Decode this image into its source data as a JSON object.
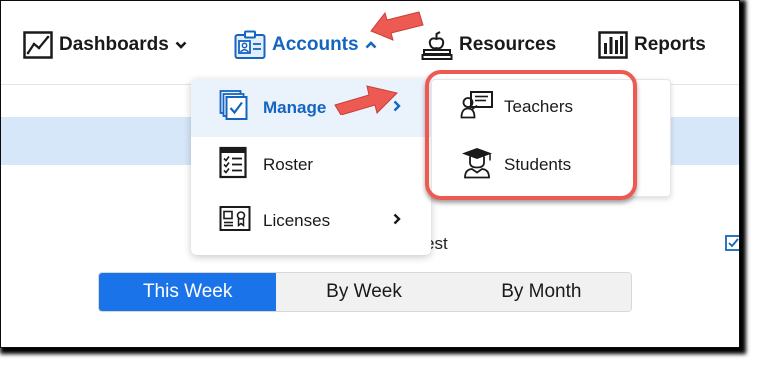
{
  "nav": {
    "dashboards": {
      "label": "Dashboards",
      "icon": "line-chart-icon"
    },
    "accounts": {
      "label": "Accounts",
      "icon": "id-card-icon",
      "color": "#1565c0"
    },
    "resources": {
      "label": "Resources",
      "icon": "apple-books-icon"
    },
    "reports": {
      "label": "Reports",
      "icon": "bar-chart-icon"
    }
  },
  "accounts_menu": {
    "items": [
      {
        "label": "Manage",
        "icon": "stacked-checklist-icon",
        "has_submenu": true,
        "active": true
      },
      {
        "label": "Roster",
        "icon": "roster-list-icon",
        "has_submenu": false
      },
      {
        "label": "Licenses",
        "icon": "license-certificate-icon",
        "has_submenu": true
      }
    ]
  },
  "manage_submenu": {
    "items": [
      {
        "label": "Teachers",
        "icon": "teacher-board-icon"
      },
      {
        "label": "Students",
        "icon": "graduate-cap-icon"
      }
    ]
  },
  "background": {
    "partial_text": "est"
  },
  "time_range": {
    "options": [
      "This Week",
      "By Week",
      "By Month"
    ],
    "selected": "This Week"
  },
  "colors": {
    "accent": "#1a73e8",
    "link": "#1565c0",
    "highlight": "#ec5a52",
    "band": "#d6e7f9"
  }
}
